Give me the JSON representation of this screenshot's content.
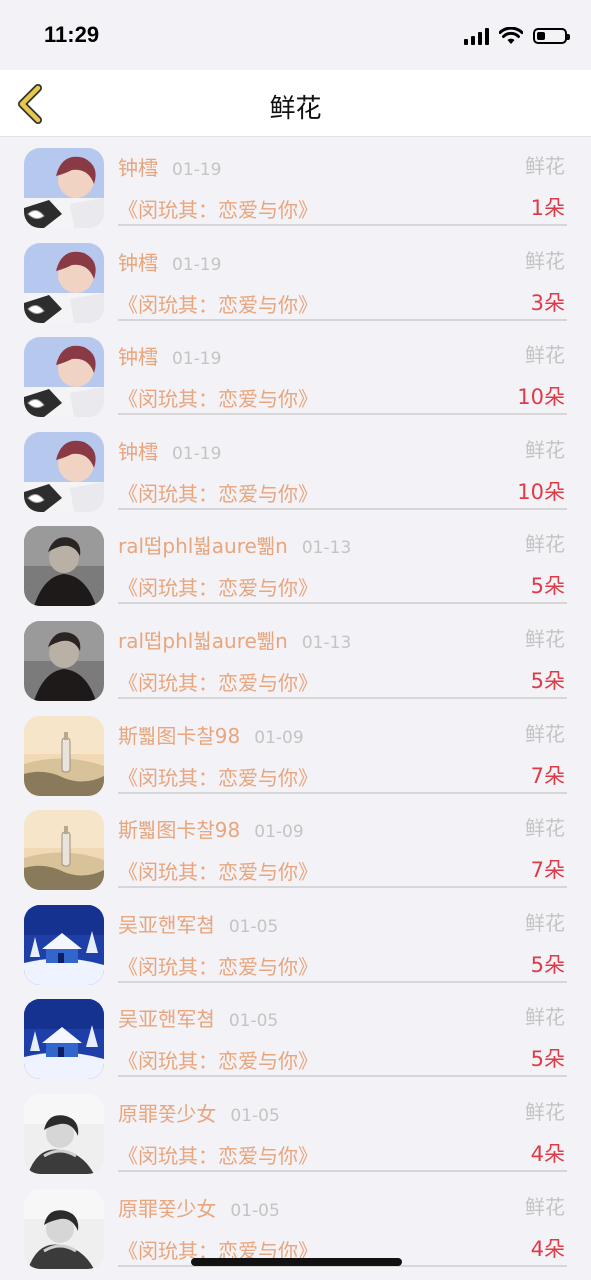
{
  "status_bar": {
    "time": "11:29"
  },
  "nav": {
    "title": "鲜花",
    "back_icon": "chevron-left-icon",
    "accent": "#e8c84a"
  },
  "colors": {
    "name": "#e9a57c",
    "meta": "#c4c4c4",
    "count": "#de3b47"
  },
  "rows": [
    {
      "user": "钟樰",
      "date": "01-19",
      "type": "鲜花",
      "book": "《闵玧其：恋爱与你》",
      "count": "1朵",
      "avatar": "avatar-boy-icon"
    },
    {
      "user": "钟樰",
      "date": "01-19",
      "type": "鲜花",
      "book": "《闵玧其：恋爱与你》",
      "count": "3朵",
      "avatar": "avatar-boy-icon"
    },
    {
      "user": "钟樰",
      "date": "01-19",
      "type": "鲜花",
      "book": "《闵玧其：恋爱与你》",
      "count": "10朵",
      "avatar": "avatar-boy-icon"
    },
    {
      "user": "钟樰",
      "date": "01-19",
      "type": "鲜花",
      "book": "《闵玧其：恋爱与你》",
      "count": "10朵",
      "avatar": "avatar-boy-icon"
    },
    {
      "user": "ral떱phl붧aure쀎n",
      "date": "01-13",
      "type": "鲜花",
      "book": "《闵玧其：恋爱与你》",
      "count": "5朵",
      "avatar": "avatar-dark-portrait-icon"
    },
    {
      "user": "ral떱phl붧aure쀎n",
      "date": "01-13",
      "type": "鲜花",
      "book": "《闵玧其：恋爱与你》",
      "count": "5朵",
      "avatar": "avatar-dark-portrait-icon"
    },
    {
      "user": "斯뿳图卡찰98",
      "date": "01-09",
      "type": "鲜花",
      "book": "《闵玧其：恋爱与你》",
      "count": "7朵",
      "avatar": "avatar-bottle-icon"
    },
    {
      "user": "斯뿳图卡찰98",
      "date": "01-09",
      "type": "鲜花",
      "book": "《闵玧其：恋爱与你》",
      "count": "7朵",
      "avatar": "avatar-bottle-icon"
    },
    {
      "user": "吴亚핸军쳠",
      "date": "01-05",
      "type": "鲜花",
      "book": "《闵玧其：恋爱与你》",
      "count": "5朵",
      "avatar": "avatar-snow-house-icon"
    },
    {
      "user": "吴亚핸军쳠",
      "date": "01-05",
      "type": "鲜花",
      "book": "《闵玧其：恋爱与你》",
      "count": "5朵",
      "avatar": "avatar-snow-house-icon"
    },
    {
      "user": "原罪쫓少女",
      "date": "01-05",
      "type": "鲜花",
      "book": "《闵玧其：恋爱与你》",
      "count": "4朵",
      "avatar": "avatar-girl-bw-icon"
    },
    {
      "user": "原罪쫓少女",
      "date": "01-05",
      "type": "鲜花",
      "book": "《闵玧其：恋爱与你》",
      "count": "4朵",
      "avatar": "avatar-girl-bw-icon"
    }
  ]
}
